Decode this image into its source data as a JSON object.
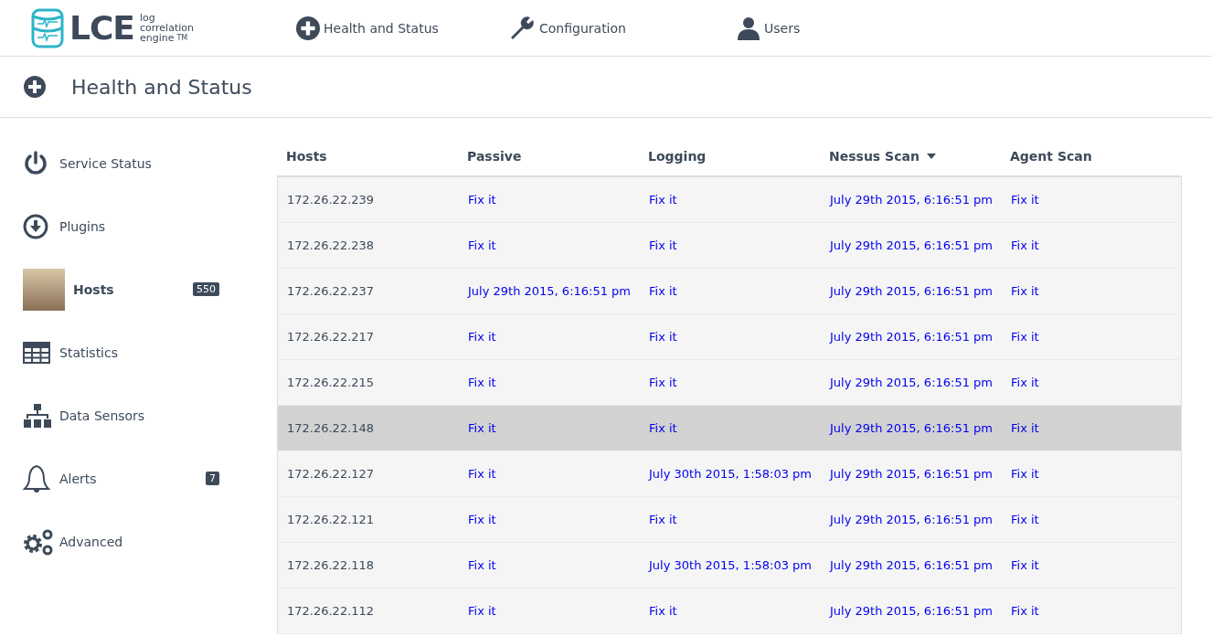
{
  "logo": {
    "mark": "LCE",
    "tagline": [
      "log",
      "correlation",
      "engine"
    ],
    "trademark": "TM"
  },
  "nav": [
    {
      "label": "Health and Status"
    },
    {
      "label": "Configuration"
    },
    {
      "label": "Users"
    }
  ],
  "page_title": "Health and Status",
  "sidebar": {
    "items": [
      {
        "label": "Service Status",
        "kind": "icon",
        "selected": false
      },
      {
        "label": "Plugins",
        "kind": "icon",
        "selected": false
      },
      {
        "label": "Hosts",
        "kind": "photo",
        "selected": true,
        "badge": "550"
      },
      {
        "label": "Statistics",
        "kind": "icon",
        "selected": false
      },
      {
        "label": "Data Sensors",
        "kind": "icon",
        "selected": false
      },
      {
        "label": "Alerts",
        "kind": "icon",
        "selected": false,
        "badge": "7"
      },
      {
        "label": "Advanced",
        "kind": "icon",
        "selected": false
      }
    ]
  },
  "table": {
    "columns": [
      {
        "label": "Hosts",
        "sorted": false
      },
      {
        "label": "Passive",
        "sorted": false
      },
      {
        "label": "Logging",
        "sorted": false
      },
      {
        "label": "Nessus Scan",
        "sorted": true
      },
      {
        "label": "Agent Scan",
        "sorted": false
      }
    ],
    "rows": [
      {
        "selected": false,
        "cells": [
          "172.26.22.239",
          "Fix it",
          "Fix it",
          "July 29th 2015, 6:16:51 pm",
          "Fix it"
        ]
      },
      {
        "selected": false,
        "cells": [
          "172.26.22.238",
          "Fix it",
          "Fix it",
          "July 29th 2015, 6:16:51 pm",
          "Fix it"
        ]
      },
      {
        "selected": false,
        "cells": [
          "172.26.22.237",
          "July 29th 2015, 6:16:51 pm",
          "Fix it",
          "July 29th 2015, 6:16:51 pm",
          "Fix it"
        ]
      },
      {
        "selected": false,
        "cells": [
          "172.26.22.217",
          "Fix it",
          "Fix it",
          "July 29th 2015, 6:16:51 pm",
          "Fix it"
        ]
      },
      {
        "selected": false,
        "cells": [
          "172.26.22.215",
          "Fix it",
          "Fix it",
          "July 29th 2015, 6:16:51 pm",
          "Fix it"
        ]
      },
      {
        "selected": true,
        "cells": [
          "172.26.22.148",
          "Fix it",
          "Fix it",
          "July 29th 2015, 6:16:51 pm",
          "Fix it"
        ]
      },
      {
        "selected": false,
        "cells": [
          "172.26.22.127",
          "Fix it",
          "July 30th 2015, 1:58:03 pm",
          "July 29th 2015, 6:16:51 pm",
          "Fix it"
        ]
      },
      {
        "selected": false,
        "cells": [
          "172.26.22.121",
          "Fix it",
          "Fix it",
          "July 29th 2015, 6:16:51 pm",
          "Fix it"
        ]
      },
      {
        "selected": false,
        "cells": [
          "172.26.22.118",
          "Fix it",
          "July 30th 2015, 1:58:03 pm",
          "July 29th 2015, 6:16:51 pm",
          "Fix it"
        ]
      },
      {
        "selected": false,
        "cells": [
          "172.26.22.112",
          "Fix it",
          "Fix it",
          "July 29th 2015, 6:16:51 pm",
          "Fix it"
        ]
      }
    ]
  }
}
